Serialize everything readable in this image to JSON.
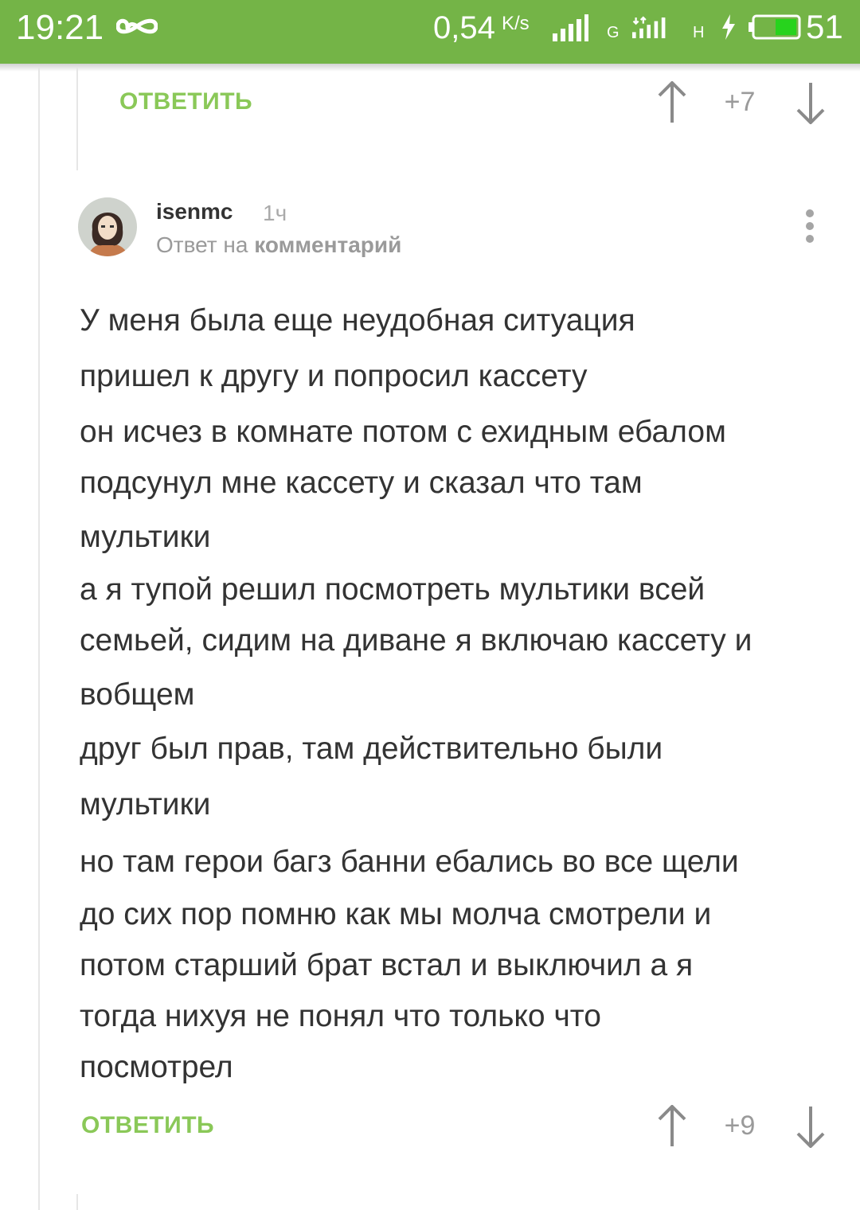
{
  "status_bar": {
    "time": "19:21",
    "speed": "0,54",
    "speed_unit": "K/s",
    "net_letter_1": "G",
    "net_letter_2": "H",
    "battery_level": "51",
    "accent_color": "#74b447"
  },
  "previous_comment": {
    "reply_label": "ОТВЕТИТЬ",
    "rating": "+7"
  },
  "comment": {
    "username": "isenmc",
    "time_ago": "1ч",
    "reply_prefix": "Ответ на",
    "reply_target": "комментарий",
    "lines": [
      "У меня была еще неудобная ситуация",
      "пришел к другу и попросил кассету",
      "он исчез в комнате потом с ехидным ебалом",
      "подсунул мне кассету и сказал что там",
      "мультики",
      "а я тупой решил посмотреть мультики всей",
      "семьей, сидим на диване я включаю кассету и",
      "вобщем",
      "друг был прав, там действительно были",
      "мультики",
      "но там герои багз банни ебались во все щели",
      "до сих пор помню как мы молча смотрели и",
      "потом старший брат встал и выключил а я",
      "тогда нихуя не понял что только что",
      "посмотрел"
    ],
    "reply_label": "ОТВЕТИТЬ",
    "rating": "+9"
  },
  "icons": {
    "vote_up": "arrow-up-icon",
    "vote_down": "arrow-down-icon",
    "more": "more-vertical-icon"
  }
}
